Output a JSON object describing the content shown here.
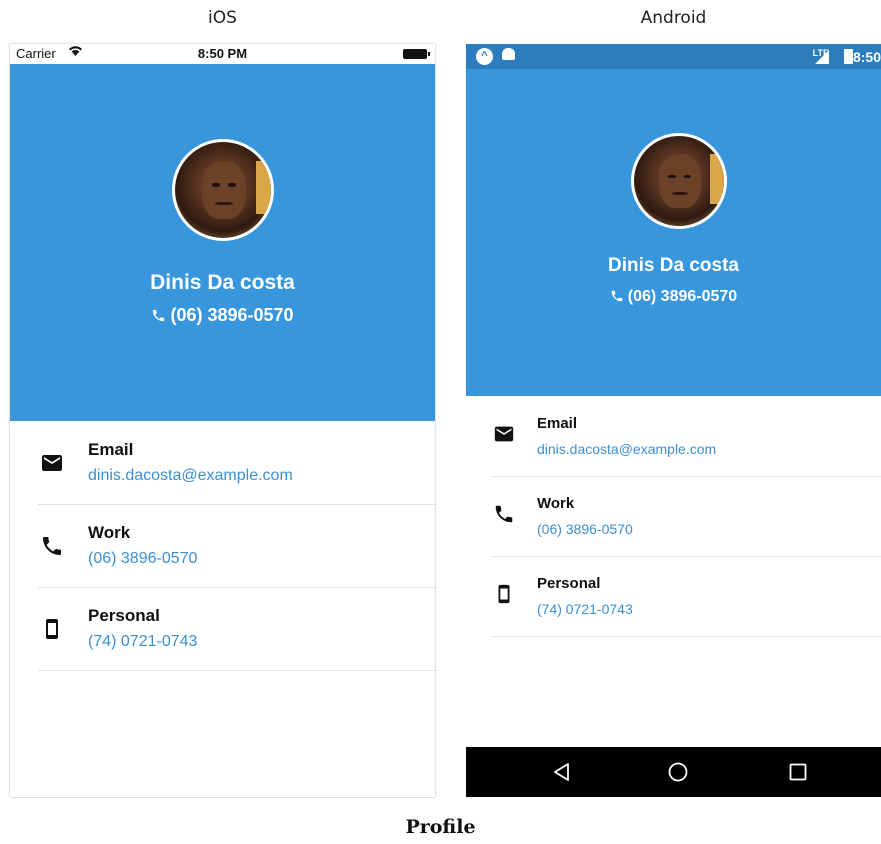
{
  "platforms": {
    "ios_title": "iOS",
    "android_title": "Android"
  },
  "caption": "Profile",
  "colors": {
    "header_blue": "#3897dc",
    "android_status_blue": "#2c7dbd",
    "link_blue": "#3a8fd4"
  },
  "ios": {
    "status": {
      "carrier": "Carrier",
      "time": "8:50 PM",
      "wifi_icon": "wifi-icon",
      "battery_icon": "battery-icon"
    },
    "profile": {
      "name": "Dinis Da costa",
      "phone": "(06) 3896-0570"
    },
    "rows": [
      {
        "icon": "mail-icon",
        "label": "Email",
        "value": "dinis.dacosta@example.com"
      },
      {
        "icon": "phone-icon",
        "label": "Work",
        "value": "(06) 3896-0570"
      },
      {
        "icon": "smartphone-icon",
        "label": "Personal",
        "value": "(74) 0721-0743"
      }
    ]
  },
  "android": {
    "status": {
      "time": "8:50",
      "network": "LTE"
    },
    "profile": {
      "name": "Dinis Da costa",
      "phone": "(06) 3896-0570"
    },
    "rows": [
      {
        "icon": "mail-icon",
        "label": "Email",
        "value": "dinis.dacosta@example.com"
      },
      {
        "icon": "phone-icon",
        "label": "Work",
        "value": "(06) 3896-0570"
      },
      {
        "icon": "smartphone-icon",
        "label": "Personal",
        "value": "(74) 0721-0743"
      }
    ],
    "nav": [
      "back-icon",
      "home-icon",
      "recents-icon"
    ]
  }
}
